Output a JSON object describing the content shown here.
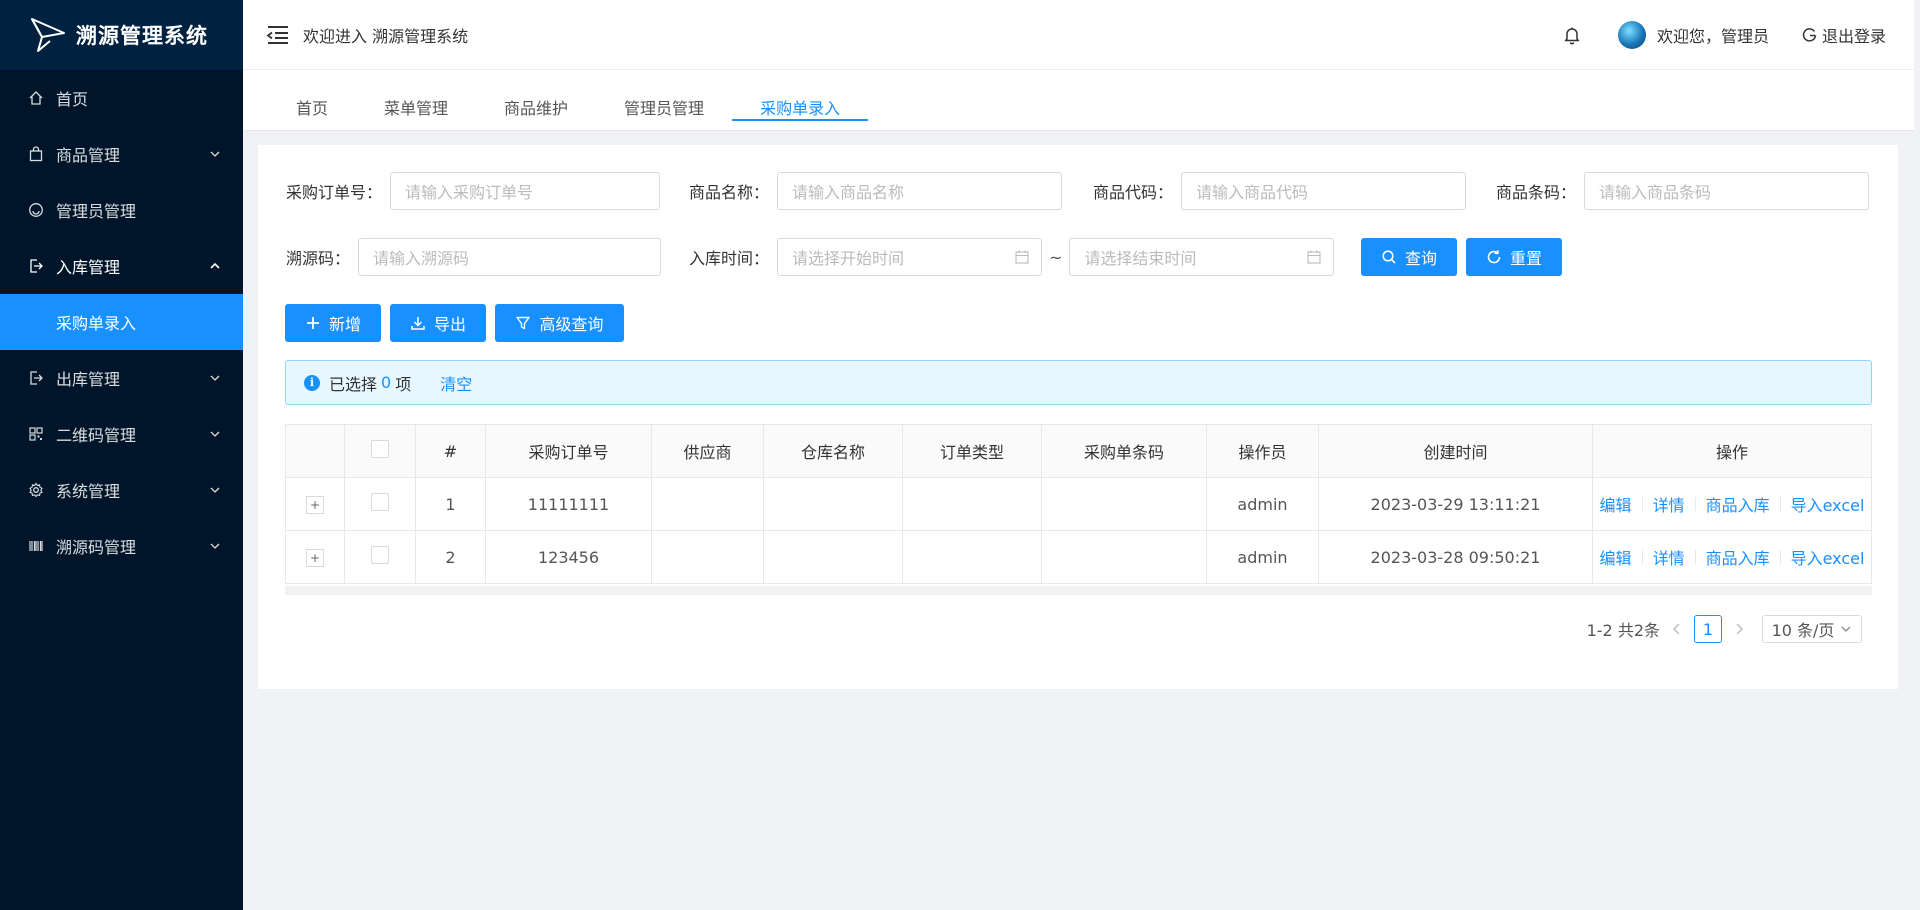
{
  "app": {
    "title": "溯源管理系统"
  },
  "sidebar": {
    "items": [
      {
        "label": "首页",
        "icon": "home-icon"
      },
      {
        "label": "商品管理",
        "icon": "bag-icon"
      },
      {
        "label": "管理员管理",
        "icon": "smile-icon"
      },
      {
        "label": "入库管理",
        "icon": "import-icon"
      },
      {
        "label": "采购单录入",
        "icon": ""
      },
      {
        "label": "出库管理",
        "icon": "export-icon"
      },
      {
        "label": "二维码管理",
        "icon": "qrcode-icon"
      },
      {
        "label": "系统管理",
        "icon": "gear-icon"
      },
      {
        "label": "溯源码管理",
        "icon": "barcode-icon"
      }
    ]
  },
  "header": {
    "welcome": "欢迎进入 溯源管理系统",
    "user_greeting": "欢迎您，管理员",
    "logout": "退出登录"
  },
  "tabs": [
    "首页",
    "菜单管理",
    "商品维护",
    "管理员管理",
    "采购单录入"
  ],
  "search": {
    "order_no_label": "采购订单号：",
    "order_no_placeholder": "请输入采购订单号",
    "product_name_label": "商品名称：",
    "product_name_placeholder": "请输入商品名称",
    "product_code_label": "商品代码：",
    "product_code_placeholder": "请输入商品代码",
    "barcode_label": "商品条码：",
    "barcode_placeholder": "请输入商品条码",
    "trace_label": "溯源码：",
    "trace_placeholder": "请输入溯源码",
    "time_label": "入库时间：",
    "start_placeholder": "请选择开始时间",
    "range_sep": "~",
    "end_placeholder": "请选择结束时间",
    "query_btn": "查询",
    "reset_btn": "重置"
  },
  "toolbar": {
    "add": "新增",
    "export": "导出",
    "advanced": "高级查询"
  },
  "alert": {
    "prefix": "已选择",
    "count": "0",
    "suffix": "项",
    "clear": "清空"
  },
  "table": {
    "headers": [
      "#",
      "采购订单号",
      "供应商",
      "仓库名称",
      "订单类型",
      "采购单条码",
      "操作员",
      "创建时间",
      "操作"
    ],
    "rows": [
      {
        "index": "1",
        "order_no": "11111111",
        "supplier": "",
        "warehouse": "",
        "type": "",
        "barcode": "",
        "operator": "admin",
        "created": "2023-03-29 13:11:21"
      },
      {
        "index": "2",
        "order_no": "123456",
        "supplier": "",
        "warehouse": "",
        "type": "",
        "barcode": "",
        "operator": "admin",
        "created": "2023-03-28 09:50:21"
      }
    ],
    "actions": [
      "编辑",
      "详情",
      "商品入库",
      "导入excel"
    ],
    "expand_symbol": "+"
  },
  "pagination": {
    "total": "1-2 共2条",
    "current": "1",
    "page_size": "10 条/页"
  },
  "colors": {
    "primary": "#1890ff",
    "sidebar_bg": "#001529",
    "logo_bg": "#002140"
  }
}
